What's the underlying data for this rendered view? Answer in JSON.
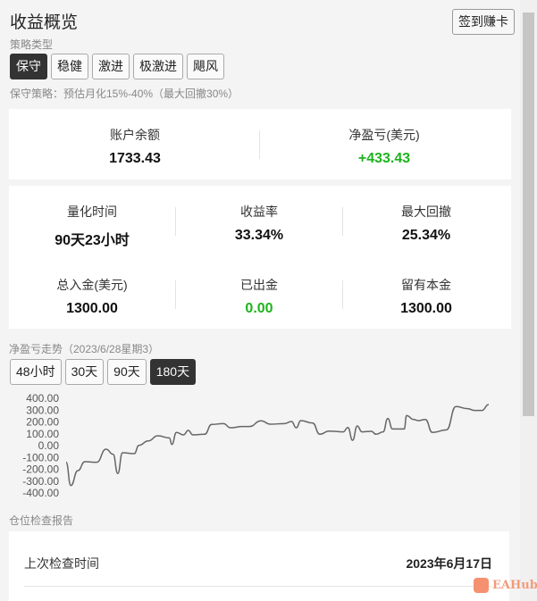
{
  "header": {
    "title": "收益概览",
    "signin_label": "签到赚卡"
  },
  "strategy": {
    "label": "策略类型",
    "options": [
      "保守",
      "稳健",
      "激进",
      "极激进",
      "飓风"
    ],
    "selected": "保守",
    "description": "保守策略：预估月化15%-40%（最大回撤30%）"
  },
  "account": {
    "balance_label": "账户余额",
    "balance": "1733.43",
    "pnl_label": "净盈亏(美元)",
    "pnl": "+433.43"
  },
  "stats": [
    {
      "label": "量化时间",
      "value": "90天23小时"
    },
    {
      "label": "收益率",
      "value": "33.34%"
    },
    {
      "label": "最大回撤",
      "value": "25.34%"
    },
    {
      "label": "总入金(美元)",
      "value": "1300.00"
    },
    {
      "label": "已出金",
      "value": "0.00"
    },
    {
      "label": "留有本金",
      "value": "1300.00"
    }
  ],
  "trend": {
    "label": "净盈亏走势（2023/6/28星期3）",
    "ranges": [
      "48小时",
      "30天",
      "90天",
      "180天"
    ],
    "selected": "180天"
  },
  "chart_data": {
    "type": "line",
    "title": "",
    "xlabel": "",
    "ylabel": "",
    "ylim": [
      -400,
      400
    ],
    "yticks": [
      "400.00",
      "300.00",
      "200.00",
      "100.00",
      "0.00",
      "-100.00",
      "-200.00",
      "-300.00",
      "-400.00"
    ],
    "x": [
      0,
      2,
      5,
      8,
      13,
      17,
      20,
      22,
      24,
      29,
      31,
      35,
      39,
      44,
      45,
      47,
      50,
      52,
      54,
      59,
      62,
      67,
      70,
      75,
      78,
      83,
      87,
      93,
      96,
      98,
      100,
      105,
      108,
      112,
      118,
      120,
      122,
      124,
      126,
      130,
      132,
      135,
      137,
      139,
      144,
      145,
      148,
      150,
      153,
      156,
      162,
      166,
      171,
      174,
      177,
      180
    ],
    "y": [
      -141,
      -337,
      -211,
      -136,
      -141,
      -30,
      -73,
      -236,
      -60,
      -68,
      2,
      40,
      83,
      65,
      10,
      111,
      91,
      128,
      91,
      96,
      179,
      186,
      151,
      161,
      161,
      209,
      181,
      186,
      204,
      151,
      211,
      191,
      96,
      123,
      116,
      153,
      45,
      166,
      116,
      121,
      96,
      116,
      229,
      141,
      141,
      254,
      221,
      211,
      221,
      111,
      133,
      330,
      312,
      297,
      297,
      347
    ],
    "color": "#666666"
  },
  "report": {
    "label": "仓位检查报告",
    "last_check_label": "上次检查时间",
    "last_check_value": "2023年6月17日"
  },
  "watermark": "EAHub"
}
